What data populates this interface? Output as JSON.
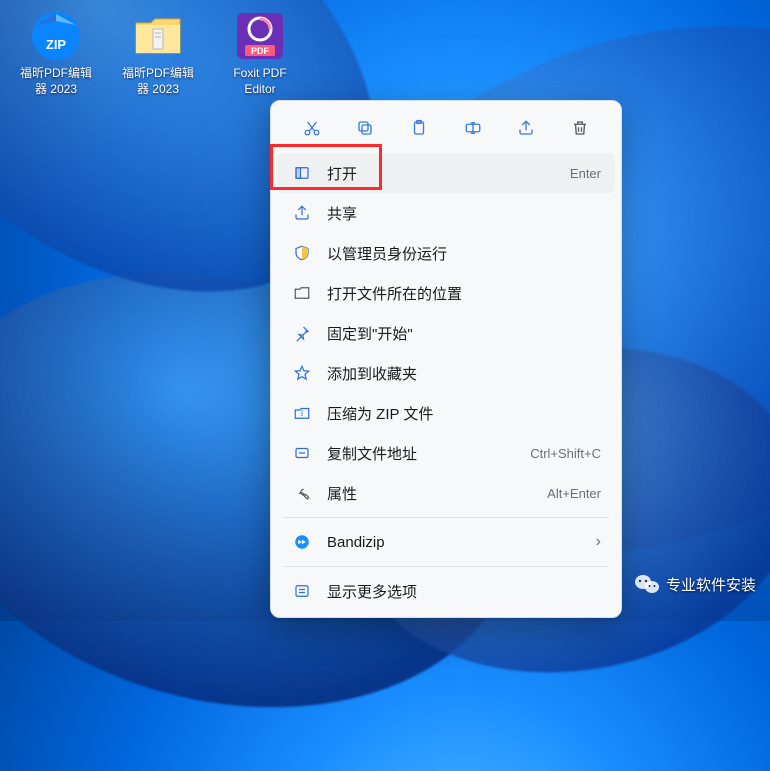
{
  "desktop": {
    "icons": [
      {
        "label": "福昕PDF编辑\n器 2023",
        "type": "zip"
      },
      {
        "label": "福昕PDF编辑\n器 2023",
        "type": "folder"
      },
      {
        "label": "Foxit PDF\nEditor",
        "type": "foxit"
      }
    ]
  },
  "context_menu": {
    "toolbar": [
      "cut",
      "copy",
      "paste",
      "rename",
      "share",
      "delete"
    ],
    "items": [
      {
        "icon": "open",
        "label": "打开",
        "shortcut": "Enter",
        "highlighted": true
      },
      {
        "icon": "share",
        "label": "共享"
      },
      {
        "icon": "shield",
        "label": "以管理员身份运行"
      },
      {
        "icon": "folder",
        "label": "打开文件所在的位置"
      },
      {
        "icon": "pin",
        "label": "固定到\"开始\""
      },
      {
        "icon": "star",
        "label": "添加到收藏夹"
      },
      {
        "icon": "zip",
        "label": "压缩为 ZIP 文件"
      },
      {
        "icon": "copypath",
        "label": "复制文件地址",
        "shortcut": "Ctrl+Shift+C"
      },
      {
        "icon": "wrench",
        "label": "属性",
        "shortcut": "Alt+Enter"
      },
      {
        "type": "sep"
      },
      {
        "icon": "bandizip",
        "label": "Bandizip",
        "submenu": true
      },
      {
        "type": "sep"
      },
      {
        "icon": "more",
        "label": "显示更多选项"
      }
    ]
  },
  "watermark": "专业软件安装"
}
